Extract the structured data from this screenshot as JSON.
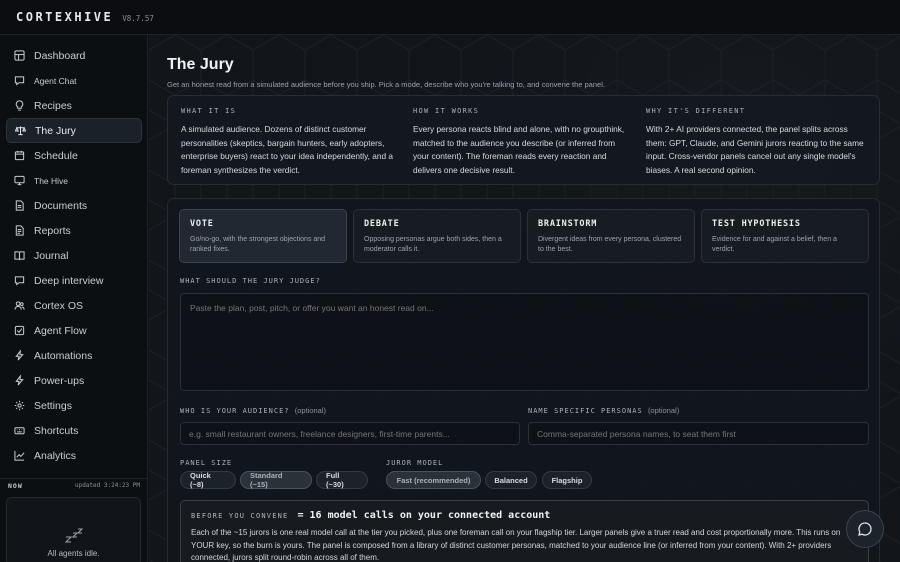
{
  "app": {
    "brand": "CORTEXHIVE",
    "version": "V8.7.57"
  },
  "sidebar": {
    "items": [
      {
        "label": "Dashboard",
        "icon": "grid-icon"
      },
      {
        "label": "Agent Chat",
        "icon": "chat-icon"
      },
      {
        "label": "Recipes",
        "icon": "bulb-icon"
      },
      {
        "label": "The Jury",
        "icon": "scales-icon"
      },
      {
        "label": "Schedule",
        "icon": "calendar-icon"
      },
      {
        "label": "The Hive",
        "icon": "monitor-icon"
      },
      {
        "label": "Documents",
        "icon": "document-icon"
      },
      {
        "label": "Reports",
        "icon": "report-icon"
      },
      {
        "label": "Journal",
        "icon": "book-icon"
      },
      {
        "label": "Deep interview",
        "icon": "mic-icon"
      },
      {
        "label": "Cortex OS",
        "icon": "users-icon"
      },
      {
        "label": "Agent Flow",
        "icon": "checkbox-icon"
      },
      {
        "label": "Automations",
        "icon": "bolt-icon"
      },
      {
        "label": "Power-ups",
        "icon": "bolt-icon"
      },
      {
        "label": "Settings",
        "icon": "gear-icon"
      },
      {
        "label": "Shortcuts",
        "icon": "keyboard-icon"
      },
      {
        "label": "Analytics",
        "icon": "chart-icon"
      }
    ],
    "now_label": "NOW",
    "updated": "updated 3:24:23 PM",
    "agents_status": "All agents idle.",
    "agents_icon": "zzz-icon"
  },
  "page": {
    "title": "The Jury",
    "subtitle": "Get an honest read from a simulated audience before you ship. Pick a mode, describe who you're talking to, and convene the panel."
  },
  "info": {
    "what_title": "WHAT IT IS",
    "what_text": "A simulated audience. Dozens of distinct customer personalities (skeptics, bargain hunters, early adopters, enterprise buyers) react to your idea independently, and a foreman synthesizes the verdict.",
    "how_title": "HOW IT WORKS",
    "how_text": "Every persona reacts blind and alone, with no groupthink, matched to the audience you describe (or inferred from your content). The foreman reads every reaction and delivers one decisive result.",
    "why_title": "WHY IT'S DIFFERENT",
    "why_text": "With 2+ AI providers connected, the panel splits across them: GPT, Claude, and Gemini jurors reacting to the same input. Cross-vendor panels cancel out any single model's biases. A real second opinion."
  },
  "modes": [
    {
      "title": "VOTE",
      "desc": "Go/no-go, with the strongest objections and ranked fixes."
    },
    {
      "title": "DEBATE",
      "desc": "Opposing personas argue both sides, then a moderator calls it."
    },
    {
      "title": "BRAINSTORM",
      "desc": "Divergent ideas from every persona, clustered to the best."
    },
    {
      "title": "TEST HYPOTHESIS",
      "desc": "Evidence for and against a belief, then a verdict."
    }
  ],
  "form": {
    "judge_label": "WHAT SHOULD THE JURY JUDGE?",
    "judge_placeholder": "Paste the plan, post, pitch, or offer you want an honest read on...",
    "audience_label": "WHO IS YOUR AUDIENCE?",
    "audience_optional": "(optional)",
    "audience_placeholder": "e.g. small restaurant owners, freelance designers, first-time parents...",
    "personas_label": "NAME SPECIFIC PERSONAS",
    "personas_optional": "(optional)",
    "personas_placeholder": "Comma-separated persona names, to seat them first",
    "panel_size_label": "PANEL SIZE",
    "panel_sizes": [
      "Quick (~8)",
      "Standard (~15)",
      "Full (~30)"
    ],
    "juror_model_label": "JUROR MODEL",
    "juror_models": [
      "Fast (recommended)",
      "Balanced",
      "Flagship"
    ]
  },
  "convene": {
    "before": "BEFORE YOU CONVENE",
    "calls": "= 16 model calls on your connected account",
    "body": "Each of the ~15 jurors is one real model call at the tier you picked, plus one foreman call on your flagship tier. Larger panels give a truer read and cost proportionally more. This runs on YOUR key, so the burn is yours. The panel is composed from a library of distinct customer personas, matched to your audience line (or inferred from your content). With 2+ providers connected, jurors split round-robin across all of them."
  },
  "colors": {
    "bg": "#0e1114",
    "panel": "#14191f",
    "accent_active": "#212831"
  }
}
